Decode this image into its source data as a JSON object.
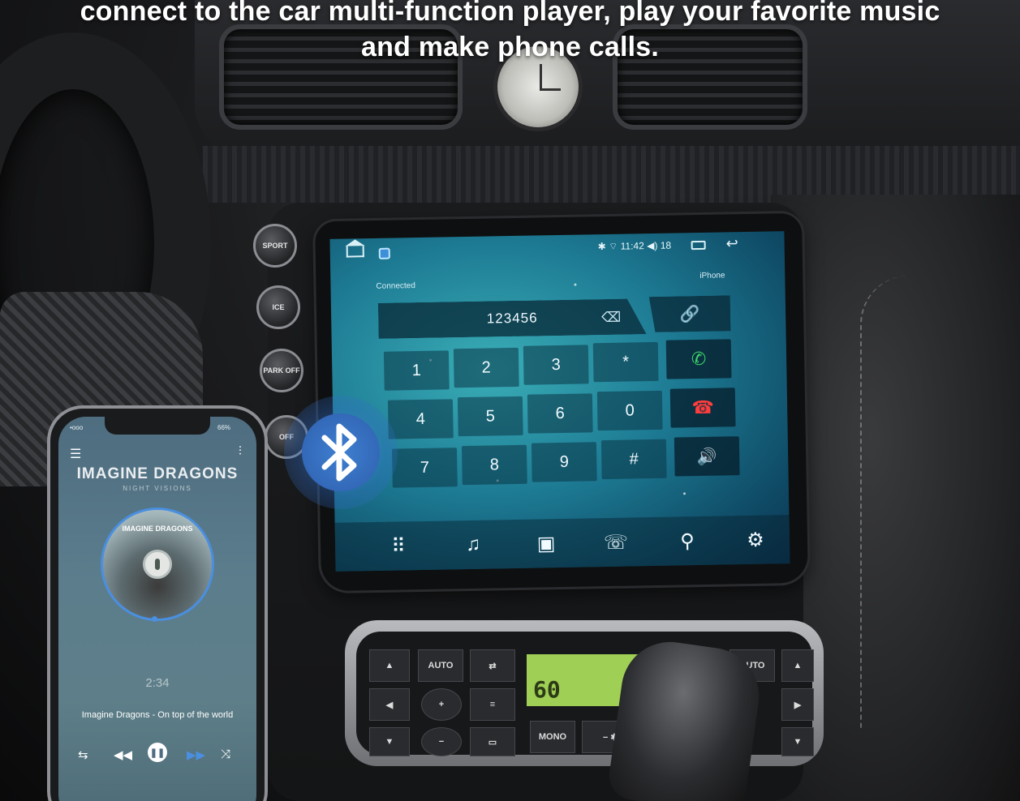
{
  "headline": {
    "line1": "connect to the car multi-function player, play your favorite music",
    "line2": "and make phone calls."
  },
  "car_buttons": {
    "sport": "SPORT",
    "ice": "ICE",
    "park": "PARK OFF",
    "airbag": "OFF"
  },
  "head_unit": {
    "status": {
      "time": "11:42",
      "volume": "18",
      "icons": [
        "home-icon",
        "app-icon",
        "bluetooth-icon",
        "wifi-icon",
        "volume-icon",
        "recent-apps-icon",
        "back-icon"
      ]
    },
    "connection_status": "Connected",
    "device_name": "iPhone",
    "dial_number": "123456",
    "keypad": [
      [
        "1",
        "2",
        "3",
        "*"
      ],
      [
        "4",
        "5",
        "6",
        "0"
      ],
      [
        "7",
        "8",
        "9",
        "#"
      ]
    ],
    "side_actions": [
      "link-icon",
      "call-icon",
      "hangup-icon",
      "speaker-icon"
    ],
    "bottom_tabs": [
      "dialpad-icon",
      "music-icon",
      "contacts-icon",
      "call-log-icon",
      "pair-icon",
      "settings-icon"
    ],
    "accent_colors": {
      "call": "#3ed26a",
      "hangup": "#ff3d3d"
    }
  },
  "climate": {
    "auto_left": "AUTO",
    "auto_right": "AUTO",
    "lcd_value": "60",
    "mono": "MONO"
  },
  "phone": {
    "status_left": "•ooo",
    "battery": "66%",
    "band_name": "IMAGINE DRAGONS",
    "album_name": "NIGHT VISIONS",
    "disc_title": "IMAGINE DRAGONS",
    "elapsed_time": "2:34",
    "track_title": "Imagine Dragons - On top of the world",
    "controls": [
      "repeat-icon",
      "previous-icon",
      "pause-icon",
      "next-icon",
      "shuffle-icon"
    ],
    "accent": "#4a8fe0"
  }
}
